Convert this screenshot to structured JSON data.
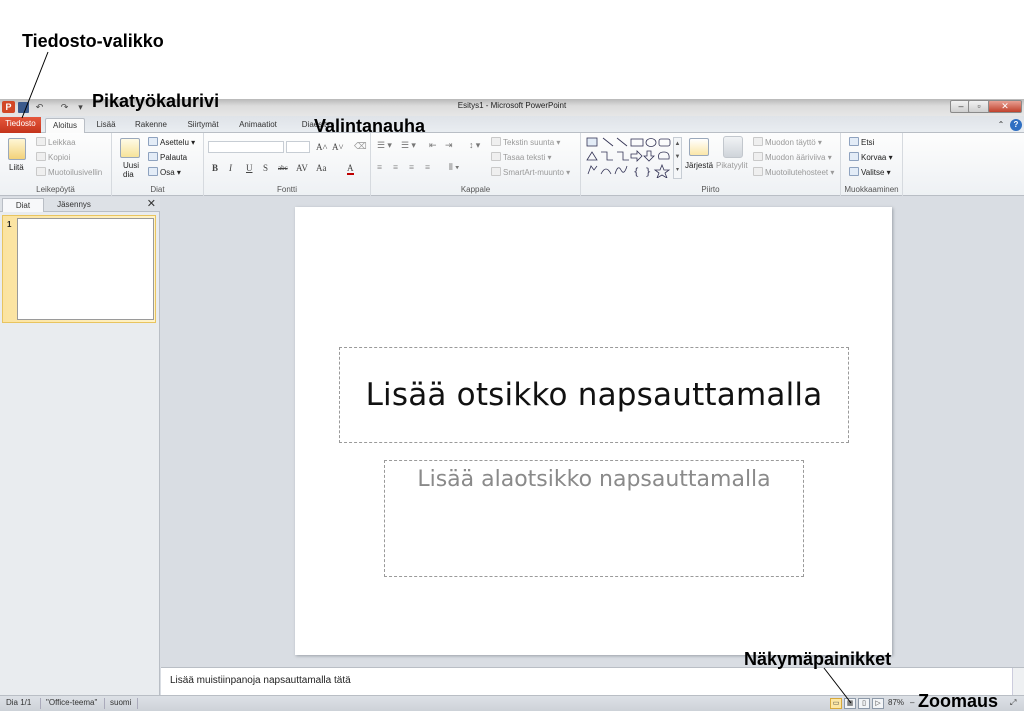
{
  "annotations": {
    "file_menu": "Tiedosto-valikko",
    "quick_access": "Pikatyökalurivi",
    "ribbon": "Valintanauha",
    "view_buttons": "Näkymäpainikket",
    "zoom": "Zoomaus"
  },
  "window": {
    "title": "Esitys1  -  Microsoft PowerPoint",
    "logo": "P",
    "minimize": "–",
    "restore": "▫",
    "close": "✕"
  },
  "quick_access": {
    "save_icon": "floppy-icon",
    "undo": "↶",
    "redo": "↷",
    "customize": "▾"
  },
  "tabs": [
    "Tiedosto",
    "Aloitus",
    "Lisää",
    "Rakenne",
    "Siirtymät",
    "Animaatiot",
    "Diaesitys"
  ],
  "ribbon": {
    "clipboard": {
      "paste": "Liitä",
      "cut": "Leikkaa",
      "copy": "Kopioi",
      "format_painter": "Muotoilusivellin",
      "label": "Leikepöytä"
    },
    "slides": {
      "new_slide_1": "Uusi",
      "new_slide_2": "dia",
      "layout": "Asettelu",
      "reset": "Palauta",
      "section": "Osa",
      "label": "Diat"
    },
    "font": {
      "grow": "A˄",
      "shrink": "A˅",
      "bold": "B",
      "italic": "I",
      "underline": "U",
      "shadow": "S",
      "strike": "abc",
      "spacing": "AV",
      "case": "Aa",
      "color": "A",
      "label": "Fontti"
    },
    "paragraph": {
      "text_direction": "Tekstin suunta",
      "align_text": "Tasaa teksti",
      "smartart": "SmartArt-muunto",
      "label": "Kappale"
    },
    "drawing": {
      "arrange": "Järjestä",
      "quick_styles": "Pikatyylit",
      "shape_fill": "Muodon täyttö",
      "shape_outline": "Muodon ääriviiva",
      "shape_effects": "Muotoilutehosteet",
      "label": "Piirto"
    },
    "editing": {
      "find": "Etsi",
      "replace": "Korvaa",
      "select": "Valitse",
      "label": "Muokkaaminen"
    }
  },
  "left_pane": {
    "tab_slides": "Diat",
    "tab_outline": "Jäsennys",
    "close": "✕",
    "slide_number": "1"
  },
  "slide": {
    "title_placeholder": "Lisää otsikko napsauttamalla",
    "subtitle_placeholder": "Lisää alaotsikko napsauttamalla"
  },
  "notes": {
    "placeholder": "Lisää muistiinpanoja napsauttamalla tätä"
  },
  "status": {
    "slide": "Dia 1/1",
    "theme": "\"Office-teema\"",
    "language": "suomi",
    "zoom": "87%",
    "zoom_out": "–",
    "fit": "⤢"
  }
}
